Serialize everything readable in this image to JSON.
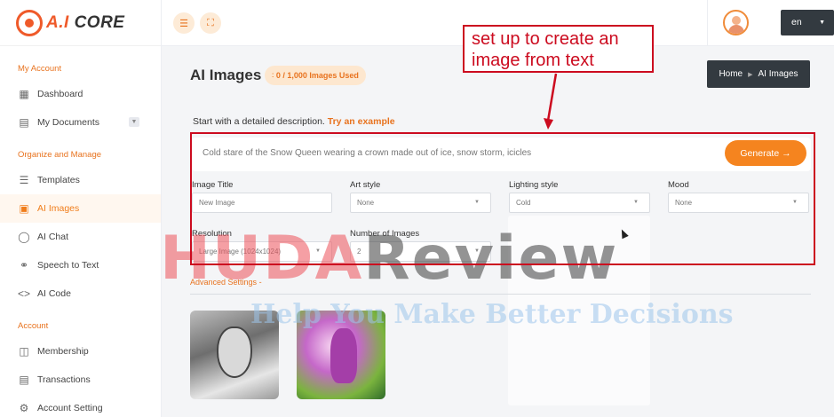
{
  "brand": {
    "logo_prefix": "A.I",
    "logo_suffix": "CORE"
  },
  "topbar": {
    "menu_icon": "hamburger-icon",
    "expand_icon": "fullscreen-icon",
    "language": "en"
  },
  "sidebar": {
    "sections": [
      {
        "title": "My Account",
        "items": [
          {
            "label": "Dashboard",
            "icon": "grid-icon"
          },
          {
            "label": "My Documents",
            "icon": "document-icon"
          }
        ]
      },
      {
        "title": "Organize and Manage",
        "items": [
          {
            "label": "Templates",
            "icon": "layers-icon"
          },
          {
            "label": "AI Images",
            "icon": "image-icon"
          },
          {
            "label": "AI Chat",
            "icon": "chat-icon"
          },
          {
            "label": "Speech to Text",
            "icon": "headphones-icon"
          },
          {
            "label": "AI Code",
            "icon": "code-icon"
          }
        ]
      },
      {
        "title": "Account",
        "items": [
          {
            "label": "Membership",
            "icon": "gift-icon"
          },
          {
            "label": "Transactions",
            "icon": "list-icon"
          },
          {
            "label": "Account Setting",
            "icon": "settings-icon"
          }
        ]
      }
    ]
  },
  "main": {
    "title": "AI Images",
    "usage_badge": "0 / 1,000 Images Used",
    "breadcrumb": {
      "home": "Home",
      "current": "AI Images"
    },
    "description_label": "Start with a detailed description.",
    "try_example": "Try an example",
    "prompt_text": "Cold stare of the Snow Queen wearing a crown made out of ice, snow storm, icicles",
    "generate_label": "Generate",
    "fields": {
      "image_title": {
        "label": "Image Title",
        "placeholder": "New Image"
      },
      "art_style": {
        "label": "Art style",
        "value": "None"
      },
      "lighting_style": {
        "label": "Lighting style",
        "value": "Cold"
      },
      "mood": {
        "label": "Mood",
        "value": "None"
      },
      "resolution": {
        "label": "Resolution",
        "value": "Large Image (1024x1024)"
      },
      "number_of_images": {
        "label": "Number of Images",
        "value": "2"
      }
    },
    "advanced_settings": "Advanced Settings"
  },
  "annotation": {
    "callout": "set up to create an image from text"
  },
  "watermark": {
    "line1a": "HUDA",
    "line1b": "Review",
    "line2": "Help You Make Better Decisions"
  },
  "colors": {
    "accent": "#f5841f",
    "annotation_red": "#cc0b1f",
    "dark_button": "#333a40"
  }
}
